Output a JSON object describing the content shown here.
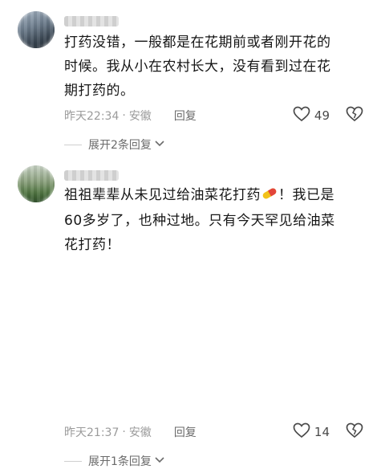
{
  "comments": [
    {
      "text_lines": [
        "打药没错，一般都是在花期前或者刚开花的",
        "时候。我从小在农村长大，没有看到过在花",
        "期打药的。"
      ],
      "time": "昨天22:34",
      "location": "安徽",
      "reply_label": "回复",
      "likes": "49",
      "expand_label": "展开2条回复"
    },
    {
      "text_lines": [
        "祖祖辈辈从未见过给油菜花打药",
        "！我已是",
        "60多岁了，也种过地。只有今天罕见给油菜",
        "花打药！"
      ],
      "time": "昨天21:37",
      "location": "安徽",
      "reply_label": "回复",
      "likes": "14",
      "expand_label": "展开1条回复"
    }
  ],
  "meta_separator": "·",
  "emoji": "pill-emoji",
  "icons": [
    "like-icon",
    "dislike-icon",
    "chevron-down-icon"
  ]
}
